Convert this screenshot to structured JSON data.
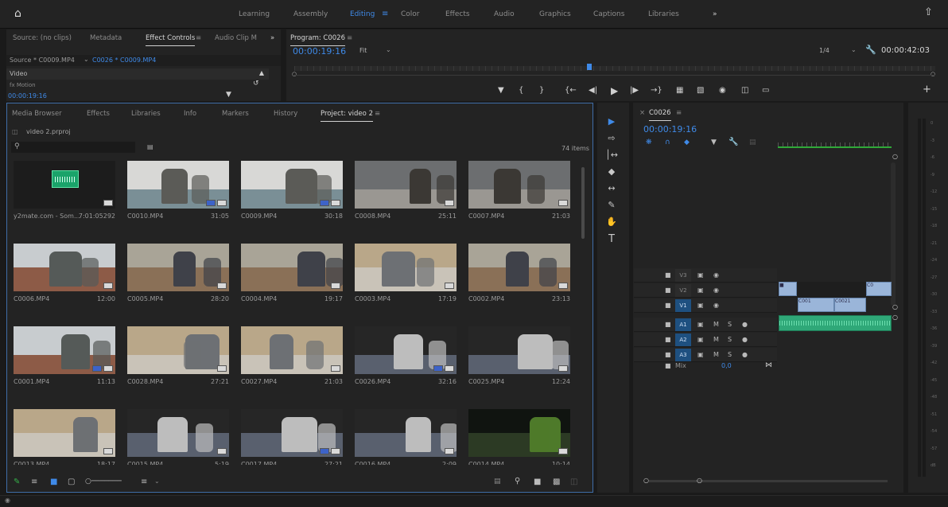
{
  "topbar": {
    "workspaces": [
      "Learning",
      "Assembly",
      "Editing",
      "Color",
      "Effects",
      "Audio",
      "Graphics",
      "Captions",
      "Libraries"
    ],
    "active": "Editing",
    "more": "»"
  },
  "source_panel": {
    "tabs": [
      "Source: (no clips)",
      "Metadata",
      "Effect Controls",
      "Audio Clip M"
    ],
    "active_tab": "Effect Controls",
    "clip_left": "Source * C0009.MP4",
    "clip_right": "C0026 * C0009.MP4",
    "section": "Video",
    "fx_label": "fx Motion",
    "timecode": "00:00:19:16"
  },
  "program_monitor": {
    "title": "Program: C0026",
    "timecode": "00:00:19:16",
    "fit": "Fit",
    "resolution": "1/4",
    "duration": "00:00:42:03"
  },
  "project_panel": {
    "tabs": [
      "Media Browser",
      "Effects",
      "Libraries",
      "Info",
      "Markers",
      "History",
      "Project: video 2"
    ],
    "active_tab": "Project: video 2",
    "project_file": "video 2.prproj",
    "item_count": "74 items",
    "clips": [
      {
        "name": "y2mate.com - Som...",
        "duration": "7:01:05292",
        "kind": "audio"
      },
      {
        "name": "C0010.MP4",
        "duration": "31:05",
        "kind": "office"
      },
      {
        "name": "C0009.MP4",
        "duration": "30:18",
        "kind": "office"
      },
      {
        "name": "C0008.MP4",
        "duration": "25:11",
        "kind": "corridor"
      },
      {
        "name": "C0007.MP4",
        "duration": "21:03",
        "kind": "corridor"
      },
      {
        "name": "C0006.MP4",
        "duration": "12:00",
        "kind": "room"
      },
      {
        "name": "C0005.MP4",
        "duration": "28:20",
        "kind": "floor"
      },
      {
        "name": "C0004.MP4",
        "duration": "19:17",
        "kind": "floor"
      },
      {
        "name": "C0003.MP4",
        "duration": "17:19",
        "kind": "cardboard"
      },
      {
        "name": "C0002.MP4",
        "duration": "23:13",
        "kind": "floor"
      },
      {
        "name": "C0001.MP4",
        "duration": "11:13",
        "kind": "room"
      },
      {
        "name": "C0028.MP4",
        "duration": "27:21",
        "kind": "cardboard"
      },
      {
        "name": "C0027.MP4",
        "duration": "21:03",
        "kind": "cardboard"
      },
      {
        "name": "C0026.MP4",
        "duration": "32:16",
        "kind": "dark"
      },
      {
        "name": "C0025.MP4",
        "duration": "12:24",
        "kind": "dark"
      },
      {
        "name": "C0013.MP4",
        "duration": "18:17",
        "kind": "cardboard"
      },
      {
        "name": "C0015.MP4",
        "duration": "5:19",
        "kind": "dark"
      },
      {
        "name": "C0017.MP4",
        "duration": "27:21",
        "kind": "dark"
      },
      {
        "name": "C0016.MP4",
        "duration": "2:09",
        "kind": "dark"
      },
      {
        "name": "C0014.MP4",
        "duration": "10:14",
        "kind": "plants"
      }
    ]
  },
  "timeline": {
    "sequence": "C0026",
    "timecode": "00:00:19:16",
    "tracks": [
      {
        "label": "V3",
        "type": "video",
        "on": false
      },
      {
        "label": "V2",
        "type": "video",
        "on": false
      },
      {
        "label": "V1",
        "type": "video",
        "on": true
      },
      {
        "label": "A1",
        "type": "audio",
        "on": true
      },
      {
        "label": "A2",
        "type": "audio",
        "on": true
      },
      {
        "label": "A3",
        "type": "audio",
        "on": true
      }
    ],
    "mix_label": "Mix",
    "mix_value": "0,0",
    "mute": "M",
    "solo": "S",
    "clips": [
      "C001",
      "C0021",
      "C0"
    ]
  },
  "meters": {
    "ticks": [
      "0",
      "-3",
      "-6",
      "-9",
      "-12",
      "-15",
      "-18",
      "-21",
      "-24",
      "-27",
      "-30",
      "-33",
      "-36",
      "-39",
      "-42",
      "-45",
      "-48",
      "-51",
      "-54",
      "-57",
      "dB"
    ]
  },
  "icons": {
    "home": "home-icon",
    "share": "share-icon",
    "search": "search-icon",
    "wrench": "wrench-icon",
    "play": "play-icon",
    "camera": "camera-icon"
  },
  "colors": {
    "accent": "#3f8ae8",
    "panel": "#232323",
    "audio_clip": "#2fa878",
    "video_clip": "#9ab5d9"
  }
}
